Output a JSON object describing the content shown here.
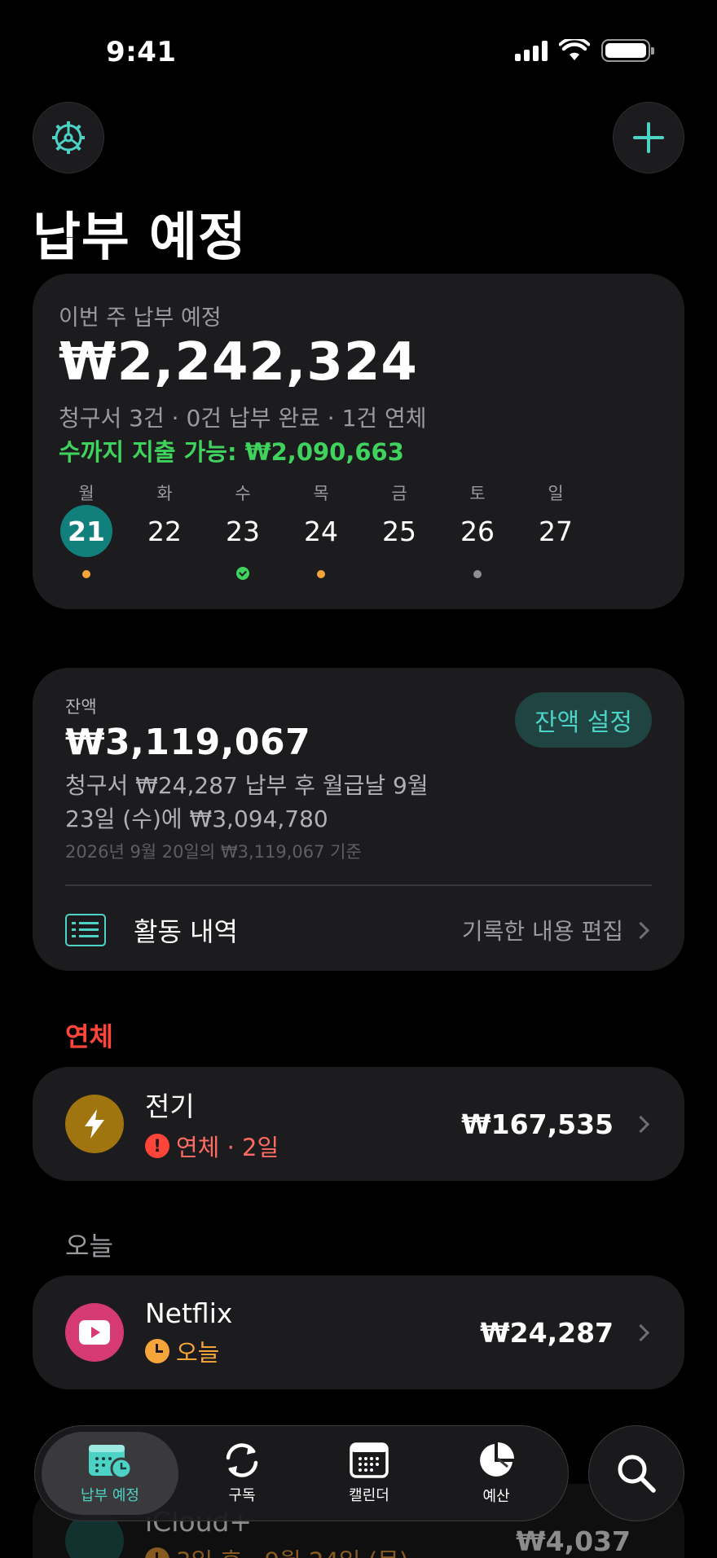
{
  "status_bar": {
    "time": "9:41"
  },
  "header": {
    "title": "납부 예정"
  },
  "colors": {
    "accent": "#4dd2c6",
    "overdue": "#ff453a",
    "positive": "#3fd35e",
    "warning": "#f6a53b"
  },
  "week_card": {
    "label": "이번 주 납부 예정",
    "total": "₩2,242,324",
    "summary": "청구서 3건 · 0건 납부 완료 · 1건 연체",
    "spendable": "수까지 지출 가능: ₩2,090,663",
    "days": [
      {
        "name": "월",
        "num": "21",
        "today": true,
        "dot": "orange"
      },
      {
        "name": "화",
        "num": "22",
        "dot": ""
      },
      {
        "name": "수",
        "num": "23",
        "dot": "green"
      },
      {
        "name": "목",
        "num": "24",
        "dot": "orange"
      },
      {
        "name": "금",
        "num": "25",
        "dot": ""
      },
      {
        "name": "토",
        "num": "26",
        "dot": "gray"
      },
      {
        "name": "일",
        "num": "27",
        "dot": ""
      }
    ]
  },
  "balance_card": {
    "label": "잔액",
    "value": "₩3,119,067",
    "note": "청구서 ₩24,287 납부 후 월급날 9월 23일 (수)에 ₩3,094,780",
    "basis": "2026년 9월 20일의 ₩3,119,067 기준",
    "set_button": "잔액 설정",
    "activity_label": "활동 내역",
    "activity_edit": "기록한 내용 편집"
  },
  "sections": {
    "overdue": {
      "title": "연체",
      "bill": {
        "name": "전기",
        "status": "연체 · 2일",
        "amount": "₩167,535",
        "icon": "bolt-icon"
      }
    },
    "today": {
      "title": "오늘",
      "bill": {
        "name": "Netflix",
        "status": "오늘",
        "amount": "₩24,287",
        "icon": "play-icon"
      }
    },
    "upcoming": {
      "bill": {
        "name": "iCloud+",
        "status": "3일 후 · 9월 24일 (목)",
        "amount": "₩4,037",
        "icon": "cloud-icon"
      }
    }
  },
  "tab_bar": {
    "tabs": [
      {
        "label": "납부 예정",
        "icon": "calendar-clock-icon",
        "active": true
      },
      {
        "label": "구독",
        "icon": "refresh-icon"
      },
      {
        "label": "캘린더",
        "icon": "calendar-icon"
      },
      {
        "label": "예산",
        "icon": "pie-chart-icon"
      }
    ],
    "search_icon": "search-icon"
  }
}
